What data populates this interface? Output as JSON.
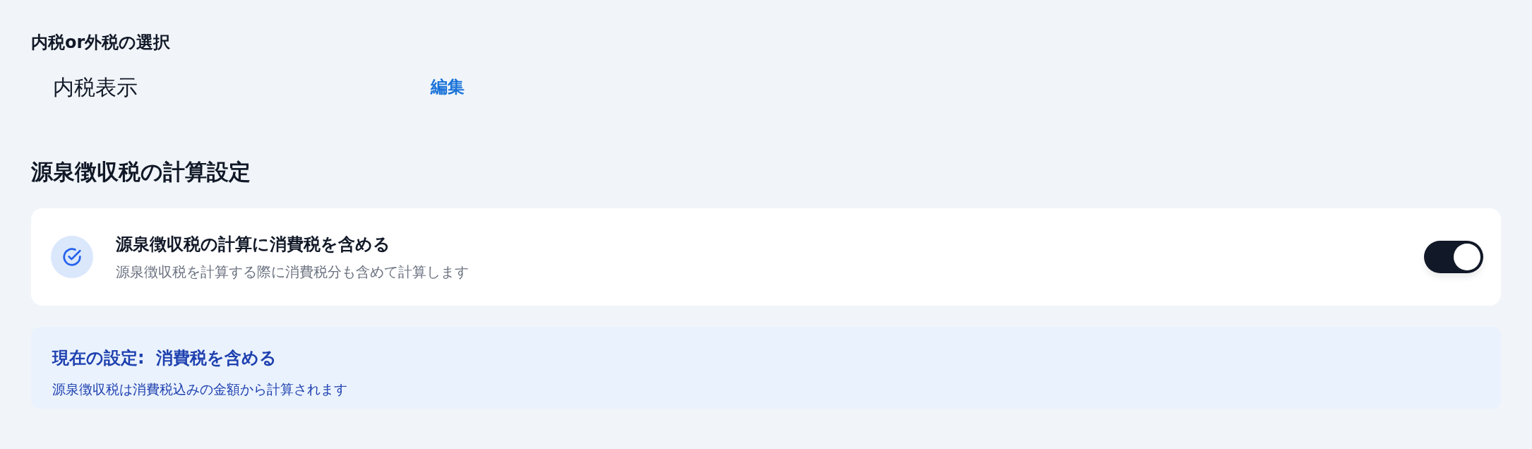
{
  "tax_mode": {
    "title": "内税or外税の選択",
    "value": "内税表示",
    "edit_link": "編集"
  },
  "withholding": {
    "title": "源泉徴収税の計算設定",
    "setting": {
      "label": "源泉徴収税の計算に消費税を含める",
      "description": "源泉徴収税を計算する際に消費税分も含めて計算します",
      "on": true
    },
    "current": {
      "title": "現在の設定:  消費税を含める",
      "description": "源泉徴収税は消費税込みの金額から計算されます"
    }
  }
}
